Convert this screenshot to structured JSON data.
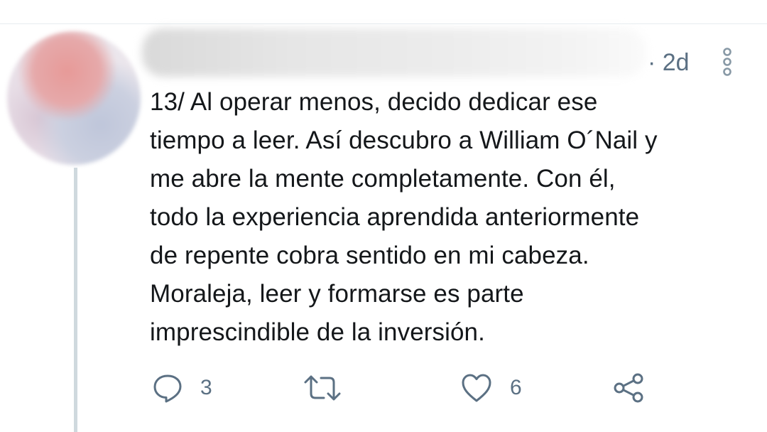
{
  "tweet": {
    "timestamp": "· 2d",
    "text": "13/ Al operar menos, decido dedicar ese\ntiempo a leer. Así descubro a William O´Nail y\nme abre la mente completamente. Con él,\ntodo la experiencia aprendida anteriormente\nde repente cobra sentido en mi cabeza.\nMoraleja, leer y formarse es parte\nimprescindible de la inversión."
  },
  "actions": {
    "reply": {
      "icon": "reply-icon",
      "count": "3"
    },
    "retweet": {
      "icon": "retweet-icon",
      "count": ""
    },
    "like": {
      "icon": "heart-icon",
      "count": "6"
    },
    "share": {
      "icon": "share-icon"
    }
  },
  "colors": {
    "text": "#14171a",
    "secondary": "#5b7083",
    "thread_line": "#cfd9de"
  }
}
